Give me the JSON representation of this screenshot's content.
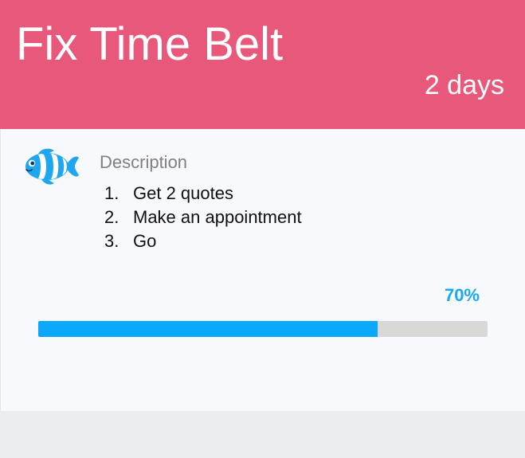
{
  "card": {
    "title": "Fix Time Belt",
    "duration": "2 days",
    "header_color": "#e8587a",
    "icon": "fish-icon"
  },
  "description": {
    "label": "Description",
    "items": [
      {
        "num": "1.",
        "text": "Get 2 quotes"
      },
      {
        "num": "2.",
        "text": "Make an appointment"
      },
      {
        "num": "3.",
        "text": "Go"
      }
    ]
  },
  "progress": {
    "label": "70%",
    "value": 0.755,
    "fill_color": "#0aa8f8",
    "track_color": "#d8d8d8"
  }
}
